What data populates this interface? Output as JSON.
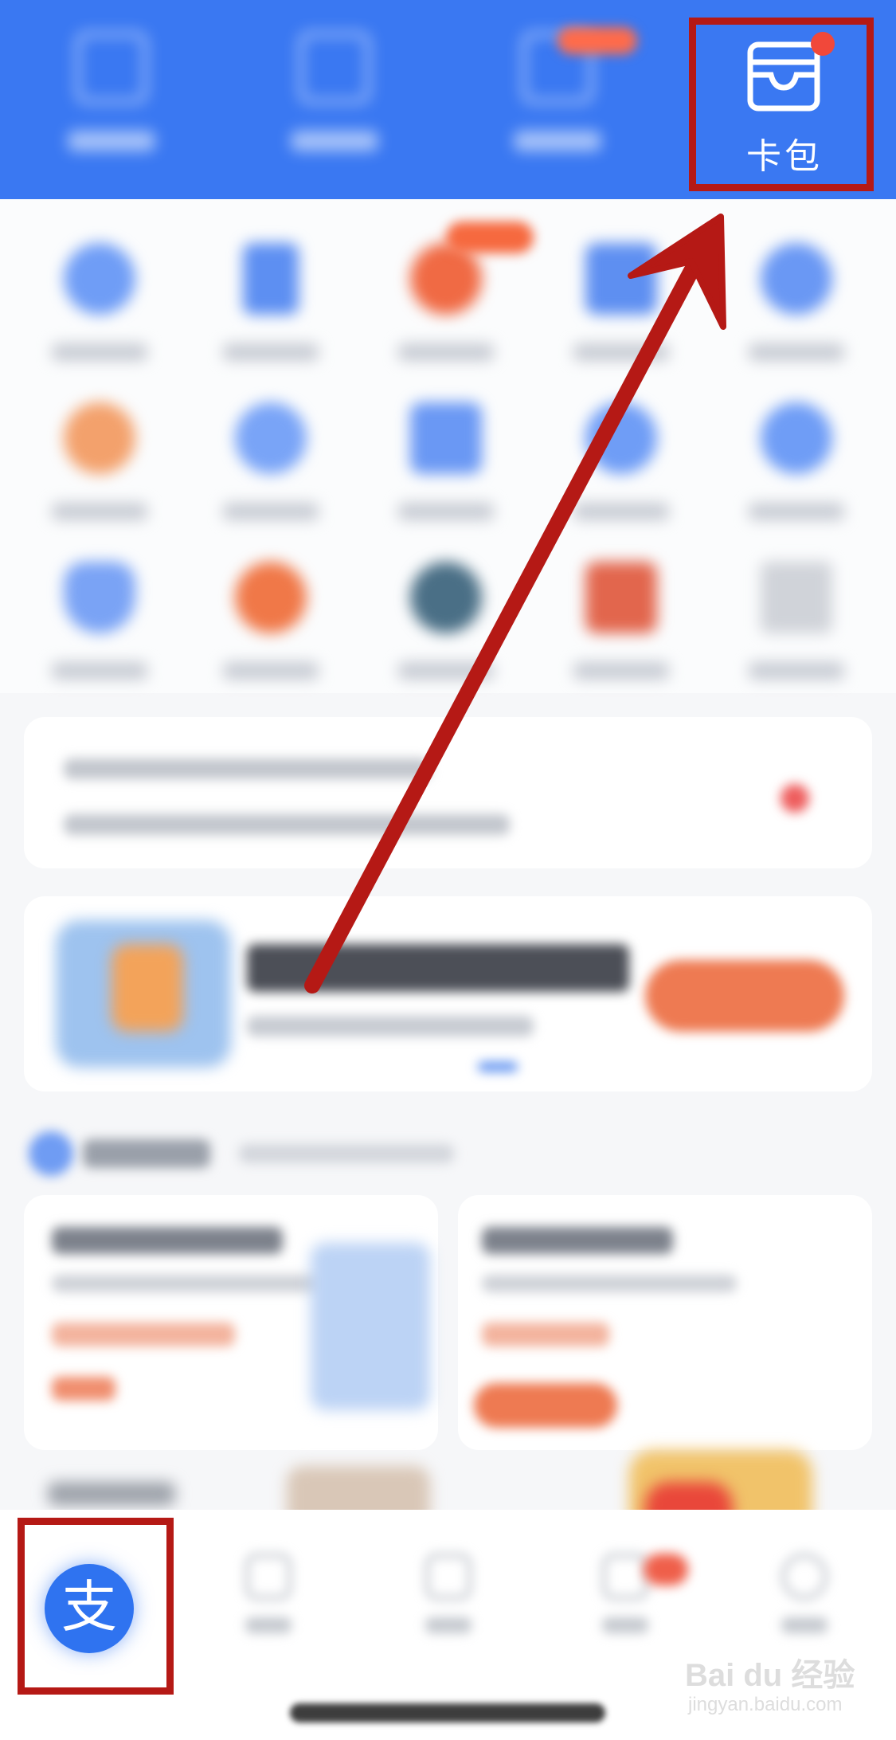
{
  "header": {
    "card_bag_label": "卡包"
  },
  "watermark": {
    "main": "Bai du 经验",
    "sub": "jingyan.baidu.com"
  },
  "colors": {
    "header_blue": "#3a78f2",
    "highlight_red": "#b51915",
    "notification_dot": "#f1483a",
    "alipay_blue": "#2f73f0",
    "promo_orange": "#ee7a52"
  },
  "icons": {
    "card_bag": "wallet-icon",
    "alipay_tab": "alipay-logo-icon"
  },
  "alipay_logo": {
    "glyph": "支"
  }
}
